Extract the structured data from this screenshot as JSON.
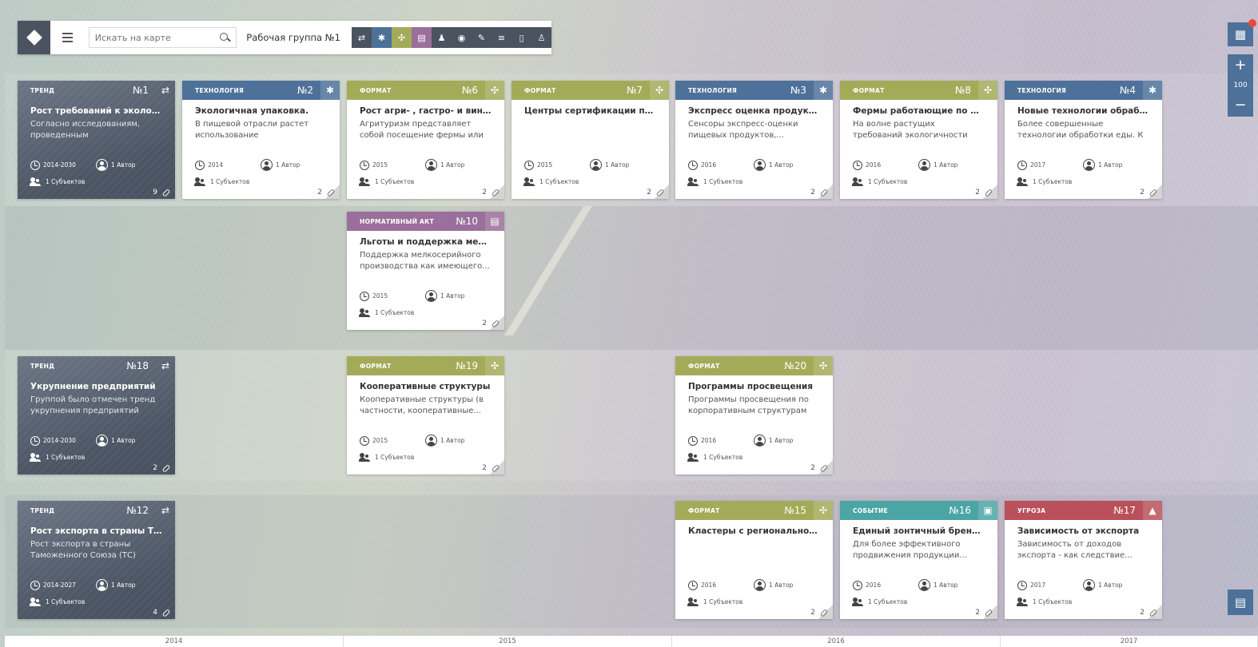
{
  "toolbar": {
    "search_placeholder": "Искать на карте",
    "group_label": "Рабочая группа №1",
    "filters": [
      {
        "icon": "arrows-icon",
        "glyph": "⇄",
        "color": "#4b5360"
      },
      {
        "icon": "gear-icon",
        "glyph": "✱",
        "color": "#4e7199"
      },
      {
        "icon": "format-icon",
        "glyph": "✣",
        "color": "#a3ab59"
      },
      {
        "icon": "document-icon",
        "glyph": "▤",
        "color": "#9a6f9b"
      },
      {
        "icon": "subjects-icon",
        "glyph": "♟",
        "color": "#4b5360"
      },
      {
        "icon": "globe-icon",
        "glyph": "◉",
        "color": "#4b5360"
      },
      {
        "icon": "wand-icon",
        "glyph": "✎",
        "color": "#4b5360"
      },
      {
        "icon": "list-icon",
        "glyph": "≡",
        "color": "#4b5360"
      },
      {
        "icon": "note-icon",
        "glyph": "▯",
        "color": "#4b5360"
      },
      {
        "icon": "user-icon",
        "glyph": "♙",
        "color": "#4b5360"
      }
    ]
  },
  "right_panel": {
    "zoom": "100",
    "zoom_in": "+",
    "zoom_out": "−",
    "table_glyph": "▦",
    "note_glyph": "▤"
  },
  "colors": {
    "trend": "#4b5360",
    "tech": "#4e7199",
    "format": "#a3ab59",
    "legal": "#9a6f9b",
    "event": "#4aa5a4",
    "threat": "#b9505a"
  },
  "cards": [
    {
      "kind": "trend",
      "type": "ТРЕНД",
      "num": "№1",
      "icon": "arrows-icon",
      "glyph": "⇄",
      "title": "Рост требований к экологично...",
      "desc": "Согласно исследованиям, проведенным американскими...",
      "date": "2014-2030",
      "author": "1 Автор",
      "subjects": "1 Субъектов",
      "links": "9"
    },
    {
      "kind": "tech",
      "type": "ТЕХНОЛОГИЯ",
      "num": "№2",
      "icon": "gear-icon",
      "glyph": "✱",
      "title": "Экологичная упаковка.",
      "desc": "В пищевой отрасли растет использование биоразлагаемо...",
      "date": "2014",
      "author": "1 Автор",
      "subjects": "1 Субъектов",
      "links": "2"
    },
    {
      "kind": "format",
      "type": "ФОРМАТ",
      "num": "№6",
      "icon": "format-icon",
      "glyph": "✣",
      "title": "Рост агри- , гастро- и винотури...",
      "desc": "Агритуризм представляет собой посещение фермы или деревн...",
      "date": "2015",
      "author": "1 Автор",
      "subjects": "1 Субъектов",
      "links": "2"
    },
    {
      "kind": "format",
      "type": "ФОРМАТ",
      "num": "№7",
      "icon": "format-icon",
      "glyph": "✣",
      "title": "Центры сертификации продук...",
      "desc": "",
      "date": "2015",
      "author": "1 Автор",
      "subjects": "1 Субъектов",
      "links": "2"
    },
    {
      "kind": "tech",
      "type": "ТЕХНОЛОГИЯ",
      "num": "№3",
      "icon": "gear-icon",
      "glyph": "✱",
      "title": "Экспресс оценка продуктов по...",
      "desc": "Сенсоры экспресс-оценки пищевых продуктов,...",
      "date": "2016",
      "author": "1 Автор",
      "subjects": "1 Субъектов",
      "links": "2"
    },
    {
      "kind": "format",
      "type": "ФОРМАТ",
      "num": "№8",
      "icon": "format-icon",
      "glyph": "✣",
      "title": "Фермы работающие по безотх...",
      "desc": "На волне растущих требований экологичности продукции, все...",
      "date": "2016",
      "author": "1 Автор",
      "subjects": "1 Субъектов",
      "links": "2"
    },
    {
      "kind": "tech",
      "type": "ТЕХНОЛОГИЯ",
      "num": "№4",
      "icon": "gear-icon",
      "glyph": "✱",
      "title": "Новые технологии обработки ...",
      "desc": "Более совершенные технологии обработки еды. К ним относятс...",
      "date": "2017",
      "author": "1 Автор",
      "subjects": "1 Субъектов",
      "links": "2"
    },
    {
      "kind": "legal",
      "type": "НОРМАТИВНЫЙ АКТ",
      "num": "№10",
      "icon": "document-icon",
      "glyph": "▤",
      "title": "Льготы и поддержка мелкосир...",
      "desc": "Поддержка мелкосерийного производства как имеющего...",
      "date": "2015",
      "author": "1 Автор",
      "subjects": "1 Субъектов",
      "links": "2"
    },
    {
      "kind": "trend",
      "type": "ТРЕНД",
      "num": "№18",
      "icon": "arrows-icon",
      "glyph": "⇄",
      "title": "Укрупнение предприятий",
      "desc": "Группой было отмечен тренд укрупнения предприятий (как...",
      "date": "2014-2030",
      "author": "1 Автор",
      "subjects": "1 Субъектов",
      "links": "2"
    },
    {
      "kind": "format",
      "type": "ФОРМАТ",
      "num": "№19",
      "icon": "format-icon",
      "glyph": "✣",
      "title": "Кооперативные структуры",
      "desc": "Кооперативные структуры (в частности, кооперативные...",
      "date": "2015",
      "author": "1 Автор",
      "subjects": "1 Субъектов",
      "links": "2"
    },
    {
      "kind": "format",
      "type": "ФОРМАТ",
      "num": "№20",
      "icon": "format-icon",
      "glyph": "✣",
      "title": "Программы просвещения",
      "desc": "Программы просвещения по корпоративным структурам",
      "date": "2016",
      "author": "1 Автор",
      "subjects": "1 Субъектов",
      "links": "2"
    },
    {
      "kind": "trend",
      "type": "ТРЕНД",
      "num": "№12",
      "icon": "arrows-icon",
      "glyph": "⇄",
      "title": "Рост экспорта в страны Тамож...",
      "desc": "Рост экспорта в страны Таможенного Союза (ТС) может...",
      "date": "2014-2027",
      "author": "1 Автор",
      "subjects": "1 Субъектов",
      "links": "4"
    },
    {
      "kind": "format",
      "type": "ФОРМАТ",
      "num": "№15",
      "icon": "format-icon",
      "glyph": "✣",
      "title": "Кластеры с региональной спец...",
      "desc": "",
      "date": "2016",
      "author": "1 Автор",
      "subjects": "1 Субъектов",
      "links": "2"
    },
    {
      "kind": "event",
      "type": "СОБЫТИЕ",
      "num": "№16",
      "icon": "calendar-icon",
      "glyph": "▣",
      "title": "Единый зонтичный бренд Арм...",
      "desc": "Для более эффективного продвижения продукции...",
      "date": "2016",
      "author": "1 Автор",
      "subjects": "1 Субъектов",
      "links": "2"
    },
    {
      "kind": "threat",
      "type": "УГРОЗА",
      "num": "№17",
      "icon": "warning-icon",
      "glyph": "▲",
      "title": "Зависимость от экспорта",
      "desc": "Зависимость от доходов экспорта - как следствие...",
      "date": "2017",
      "author": "1 Автор",
      "subjects": "1 Субъектов",
      "links": "2"
    }
  ],
  "timeline": [
    "2014",
    "2015",
    "2016",
    "2017"
  ]
}
